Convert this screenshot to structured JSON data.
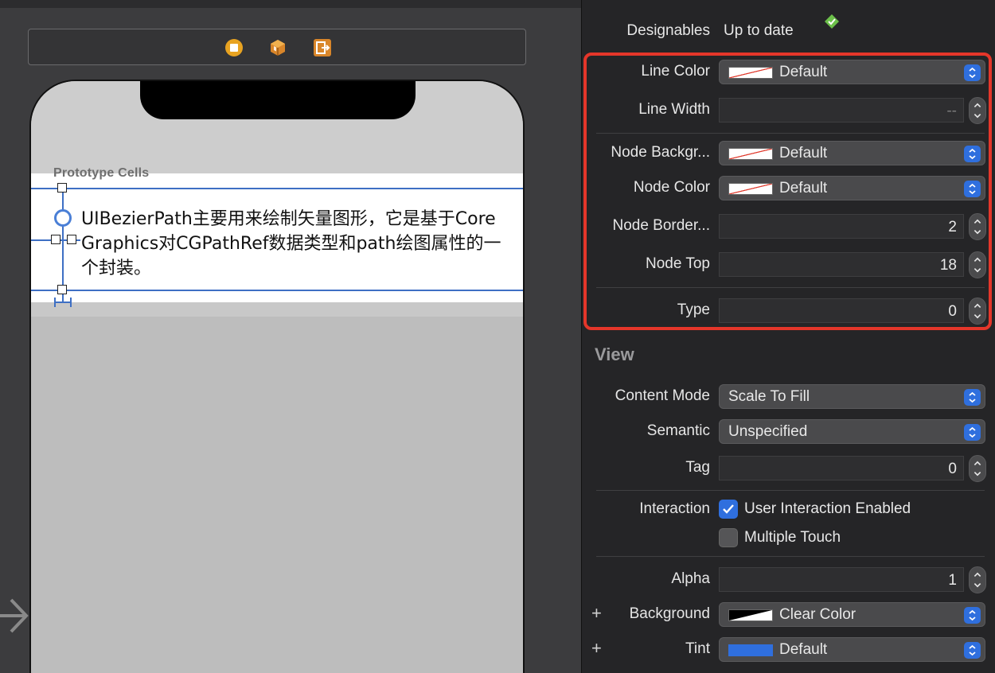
{
  "canvas": {
    "prototype_label": "Prototype Cells",
    "cell_text": "UIBezierPath主要用来绘制矢量图形，它是基于Core Graphics对CGPathRef数据类型和path绘图属性的一个封装。"
  },
  "inspector": {
    "designables": {
      "label": "Designables",
      "value": "Up to date"
    },
    "line_color": {
      "label": "Line Color",
      "value": "Default"
    },
    "line_width": {
      "label": "Line Width",
      "value": "--"
    },
    "node_background": {
      "label": "Node Backgr...",
      "value": "Default"
    },
    "node_color": {
      "label": "Node Color",
      "value": "Default"
    },
    "node_border": {
      "label": "Node Border...",
      "value": "2"
    },
    "node_top": {
      "label": "Node Top",
      "value": "18"
    },
    "type": {
      "label": "Type",
      "value": "0"
    },
    "view_section": "View",
    "content_mode": {
      "label": "Content Mode",
      "value": "Scale To Fill"
    },
    "semantic": {
      "label": "Semantic",
      "value": "Unspecified"
    },
    "tag": {
      "label": "Tag",
      "value": "0"
    },
    "interaction": {
      "label": "Interaction",
      "user_interaction": "User Interaction Enabled",
      "user_interaction_checked": true,
      "multiple_touch": "Multiple Touch",
      "multiple_touch_checked": false
    },
    "alpha": {
      "label": "Alpha",
      "value": "1"
    },
    "background": {
      "label": "Background",
      "value": "Clear Color"
    },
    "tint": {
      "label": "Tint",
      "value": "Default"
    },
    "plus": "+"
  },
  "colors": {
    "highlight": "#e5362a",
    "accent": "#2f6fde",
    "badge": "#6cc04a"
  }
}
